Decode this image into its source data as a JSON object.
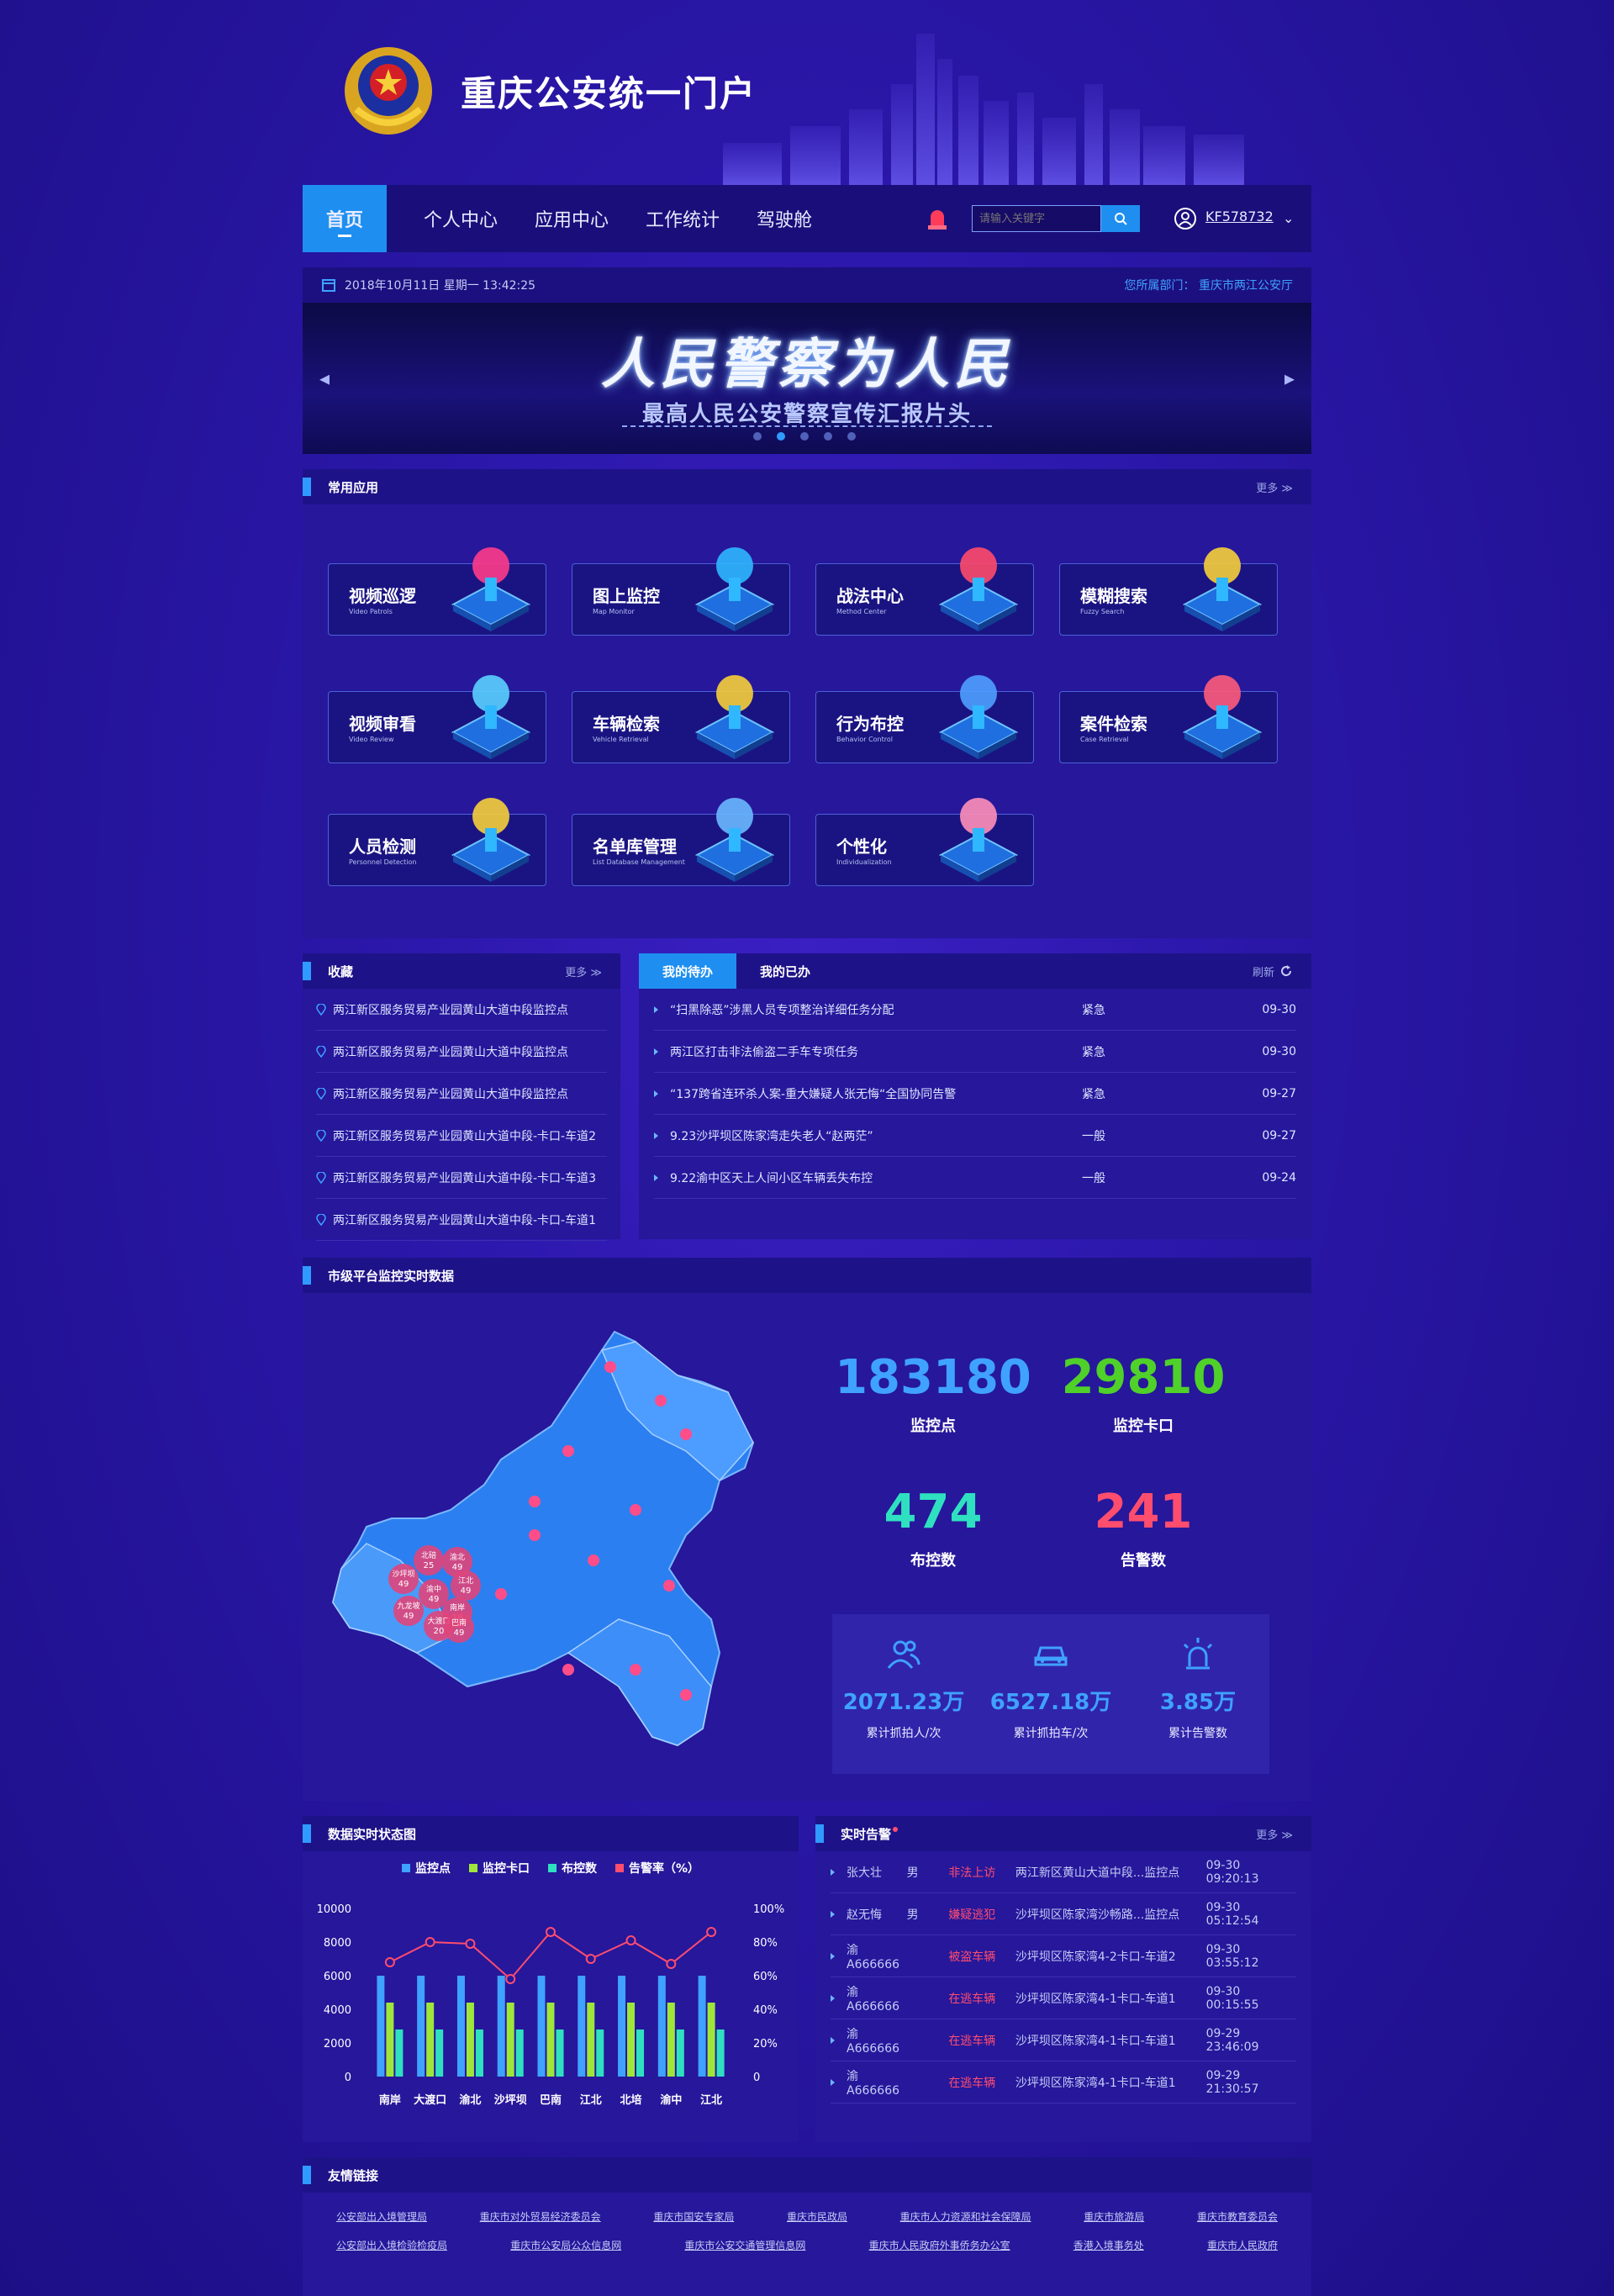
{
  "header": {
    "title": "重庆公安统一门户"
  },
  "nav": {
    "items": [
      "首页",
      "个人中心",
      "应用中心",
      "工作统计",
      "驾驶舱"
    ],
    "search_placeholder": "请输入关键字",
    "user": "KF578732"
  },
  "datebar": {
    "datetime": "2018年10月11日  星期一  13:42:25",
    "dept": "您所属部门：  重庆市两江公安厅"
  },
  "banner": {
    "slogan": "人民警察为人民",
    "subtitle": "最高人民公安警察宣传汇报片头",
    "slide_count": 5,
    "active_slide": 2
  },
  "apps": {
    "title": "常用应用",
    "more": "更多 ≫",
    "items": [
      {
        "name": "视频巡逻",
        "en": "Video Patrols",
        "icon": "camera-patrol-icon"
      },
      {
        "name": "图上监控",
        "en": "Map Monitor",
        "icon": "map-camera-icon"
      },
      {
        "name": "战法中心",
        "en": "Method Center",
        "icon": "gears-icon"
      },
      {
        "name": "模糊搜索",
        "en": "Fuzzy Search",
        "icon": "search-icon"
      },
      {
        "name": "视频审看",
        "en": "Video Review",
        "icon": "video-review-icon"
      },
      {
        "name": "车辆检索",
        "en": "Vehicle Retrieval",
        "icon": "vehicle-icon"
      },
      {
        "name": "行为布控",
        "en": "Behavior Control",
        "icon": "location-pin-icon"
      },
      {
        "name": "案件检索",
        "en": "Case Retrieval",
        "icon": "case-search-icon"
      },
      {
        "name": "人员检测",
        "en": "Personnel Detection",
        "icon": "person-detect-icon"
      },
      {
        "name": "名单库管理",
        "en": "List Database Management",
        "icon": "list-db-icon"
      },
      {
        "name": "个性化",
        "en": "Individualization",
        "icon": "cube-icon"
      }
    ]
  },
  "favorites": {
    "title": "收藏",
    "more": "更多 ≫",
    "items": [
      "两江新区服务贸易产业园黄山大道中段监控点",
      "两江新区服务贸易产业园黄山大道中段监控点",
      "两江新区服务贸易产业园黄山大道中段监控点",
      "两江新区服务贸易产业园黄山大道中段-卡口-车道2",
      "两江新区服务贸易产业园黄山大道中段-卡口-车道3",
      "两江新区服务贸易产业园黄山大道中段-卡口-车道1"
    ]
  },
  "todo": {
    "tabs": [
      "我的待办",
      "我的已办"
    ],
    "refresh": "刷新",
    "items": [
      {
        "title": "“扫黑除恶”涉黑人员专项整治详细任务分配",
        "level": "紧急",
        "date": "09-30"
      },
      {
        "title": "两江区打击非法偷盗二手车专项任务",
        "level": "紧急",
        "date": "09-30"
      },
      {
        "title": "“137跨省连环杀人案-重大嫌疑人张无悔“全国协同告警",
        "level": "紧急",
        "date": "09-27"
      },
      {
        "title": "9.23沙坪坝区陈家湾走失老人“赵两茫”",
        "level": "一般",
        "date": "09-27"
      },
      {
        "title": "9.22渝中区天上人间小区车辆丢失布控",
        "level": "一般",
        "date": "09-24"
      }
    ]
  },
  "monitor": {
    "title": "市级平台监控实时数据",
    "map_labels": [
      {
        "name": "北碚",
        "value": "25"
      },
      {
        "name": "渝北",
        "value": "49"
      },
      {
        "name": "沙坪坝",
        "value": "49"
      },
      {
        "name": "渝中",
        "value": "49"
      },
      {
        "name": "江北",
        "value": "49"
      },
      {
        "name": "南岸",
        "value": "19"
      },
      {
        "name": "九龙坡",
        "value": "49"
      },
      {
        "name": "大渡口",
        "value": "20"
      },
      {
        "name": "巴南",
        "value": "49"
      }
    ],
    "stats": [
      {
        "value": "183180",
        "label": "监控点",
        "color": "#3fa2ff"
      },
      {
        "value": "29810",
        "label": "监控卡口",
        "color": "#4fd12a"
      },
      {
        "value": "474",
        "label": "布控数",
        "color": "#2fe0c0"
      },
      {
        "value": "241",
        "label": "告警数",
        "color": "#ff4d6e"
      }
    ],
    "subs": [
      {
        "value": "2071.23万",
        "label": "累计抓拍人/次",
        "icon": "people-icon"
      },
      {
        "value": "6527.18万",
        "label": "累计抓拍车/次",
        "icon": "car-icon"
      },
      {
        "value": "3.85万",
        "label": "累计告警数",
        "icon": "alarm-light-icon"
      }
    ]
  },
  "chart_panel": {
    "title": "数据实时状态图"
  },
  "chart_data": {
    "type": "bar",
    "categories": [
      "南岸",
      "大渡口",
      "渝北",
      "沙坪坝",
      "巴南",
      "江北",
      "北培",
      "渝中",
      "江北"
    ],
    "series": [
      {
        "name": "监控点",
        "values": [
          6000,
          6000,
          6000,
          6000,
          6000,
          6000,
          6000,
          6000,
          6000
        ],
        "color": "#3fa2ff",
        "axis": "left"
      },
      {
        "name": "监控卡口",
        "values": [
          4400,
          4400,
          4400,
          4400,
          4400,
          4400,
          4400,
          4400,
          4400
        ],
        "color": "#9ee63a",
        "axis": "left"
      },
      {
        "name": "布控数",
        "values": [
          2800,
          2800,
          2800,
          2800,
          2800,
          2800,
          2800,
          2800,
          2800
        ],
        "color": "#2fe0c0",
        "axis": "left"
      },
      {
        "name": "告警率（%）",
        "values": [
          68,
          80,
          79,
          58,
          86,
          70,
          81,
          67,
          86
        ],
        "color": "#ff4d6e",
        "axis": "right",
        "type": "line"
      }
    ],
    "yticks_left": [
      "10000",
      "8000",
      "6000",
      "4000",
      "2000",
      "0"
    ],
    "yticks_right": [
      "100%",
      "80%",
      "60%",
      "40%",
      "20%",
      "0"
    ],
    "ylim": [
      0,
      10000
    ],
    "ylim_right": [
      0,
      100
    ],
    "legend": "top-center",
    "grid": false
  },
  "alarms": {
    "title": "实时告警",
    "more": "更多 ≫",
    "items": [
      {
        "name": "张大壮",
        "sex": "男",
        "status": "非法上访",
        "place": "两江新区黄山大道中段...监控点",
        "time": "09-30  09:20:13"
      },
      {
        "name": "赵无悔",
        "sex": "男",
        "status": "嫌疑逃犯",
        "place": "沙坪坝区陈家湾沙畅路...监控点",
        "time": "09-30  05:12:54"
      },
      {
        "name": "渝A666666",
        "sex": "",
        "status": "被盗车辆",
        "place": "沙坪坝区陈家湾4-2卡口-车道2",
        "time": "09-30  03:55:12"
      },
      {
        "name": "渝A666666",
        "sex": "",
        "status": "在逃车辆",
        "place": "沙坪坝区陈家湾4-1卡口-车道1",
        "time": "09-30  00:15:55"
      },
      {
        "name": "渝A666666",
        "sex": "",
        "status": "在逃车辆",
        "place": "沙坪坝区陈家湾4-1卡口-车道1",
        "time": "09-29  23:46:09"
      },
      {
        "name": "渝A666666",
        "sex": "",
        "status": "在逃车辆",
        "place": "沙坪坝区陈家湾4-1卡口-车道1",
        "time": "09-29  21:30:57"
      }
    ]
  },
  "links": {
    "title": "友情链接",
    "row1": [
      "公安部出入境管理局",
      "重庆市对外贸易经济委员会",
      "重庆市国安专家局",
      "重庆市民政局",
      "重庆市人力资源和社会保障局",
      "重庆市旅游局",
      "重庆市教育委员会"
    ],
    "row2": [
      "公安部出入境检验检疫局",
      "重庆市公安局公众信息网",
      "重庆市公安交通管理信息网",
      "重庆市人民政府外事侨务办公室",
      "香港入境事务处",
      "重庆市人民政府"
    ]
  }
}
